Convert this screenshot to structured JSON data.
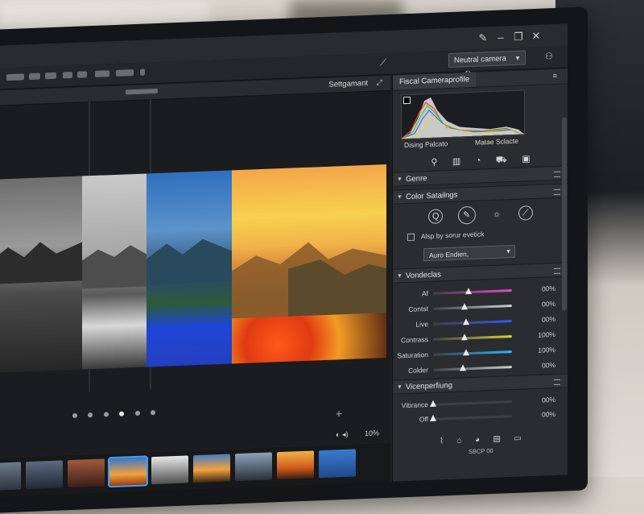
{
  "window": {
    "profile_select": "Neutral camera profile"
  },
  "viewer": {
    "title": "Settgamant",
    "zoom": "10%"
  },
  "panel": {
    "histogram_tab": "Fiscal Cameraprofile",
    "histogram_left_label": "Dising Palcato",
    "histogram_right_label": "Matae Sclacte",
    "sections": {
      "genre": "Genre",
      "color_settings": "Color Satailngs",
      "vandecks": "Vondeclas",
      "vignetting": "Vicenperfiung"
    },
    "checkbox_label": "Alsp by sorur evetick",
    "preset_value": "Auro Endien,",
    "sliders": [
      {
        "label": "Af",
        "value": "00%",
        "color": "#e04bd6",
        "level": 0.45
      },
      {
        "label": "Contst",
        "value": "00%",
        "color": "#cfcfcf",
        "level": 0.4
      },
      {
        "label": "Live",
        "value": "00%",
        "color": "#2f5bff",
        "level": 0.42
      },
      {
        "label": "Contrass",
        "value": "100%",
        "color": "#d6d82b",
        "level": 0.4
      },
      {
        "label": "Saturation",
        "value": "100%",
        "color": "#2bb7ff",
        "level": 0.42
      },
      {
        "label": "Colder",
        "value": "00%",
        "color": "#cfcfcf",
        "level": 0.38
      }
    ],
    "vignette_sliders": [
      {
        "label": "Vibrance",
        "value": "00%",
        "level": 0.0
      },
      {
        "label": "Off",
        "value": "00%",
        "level": 0.0
      }
    ],
    "footer_text": "SBCP 00"
  }
}
